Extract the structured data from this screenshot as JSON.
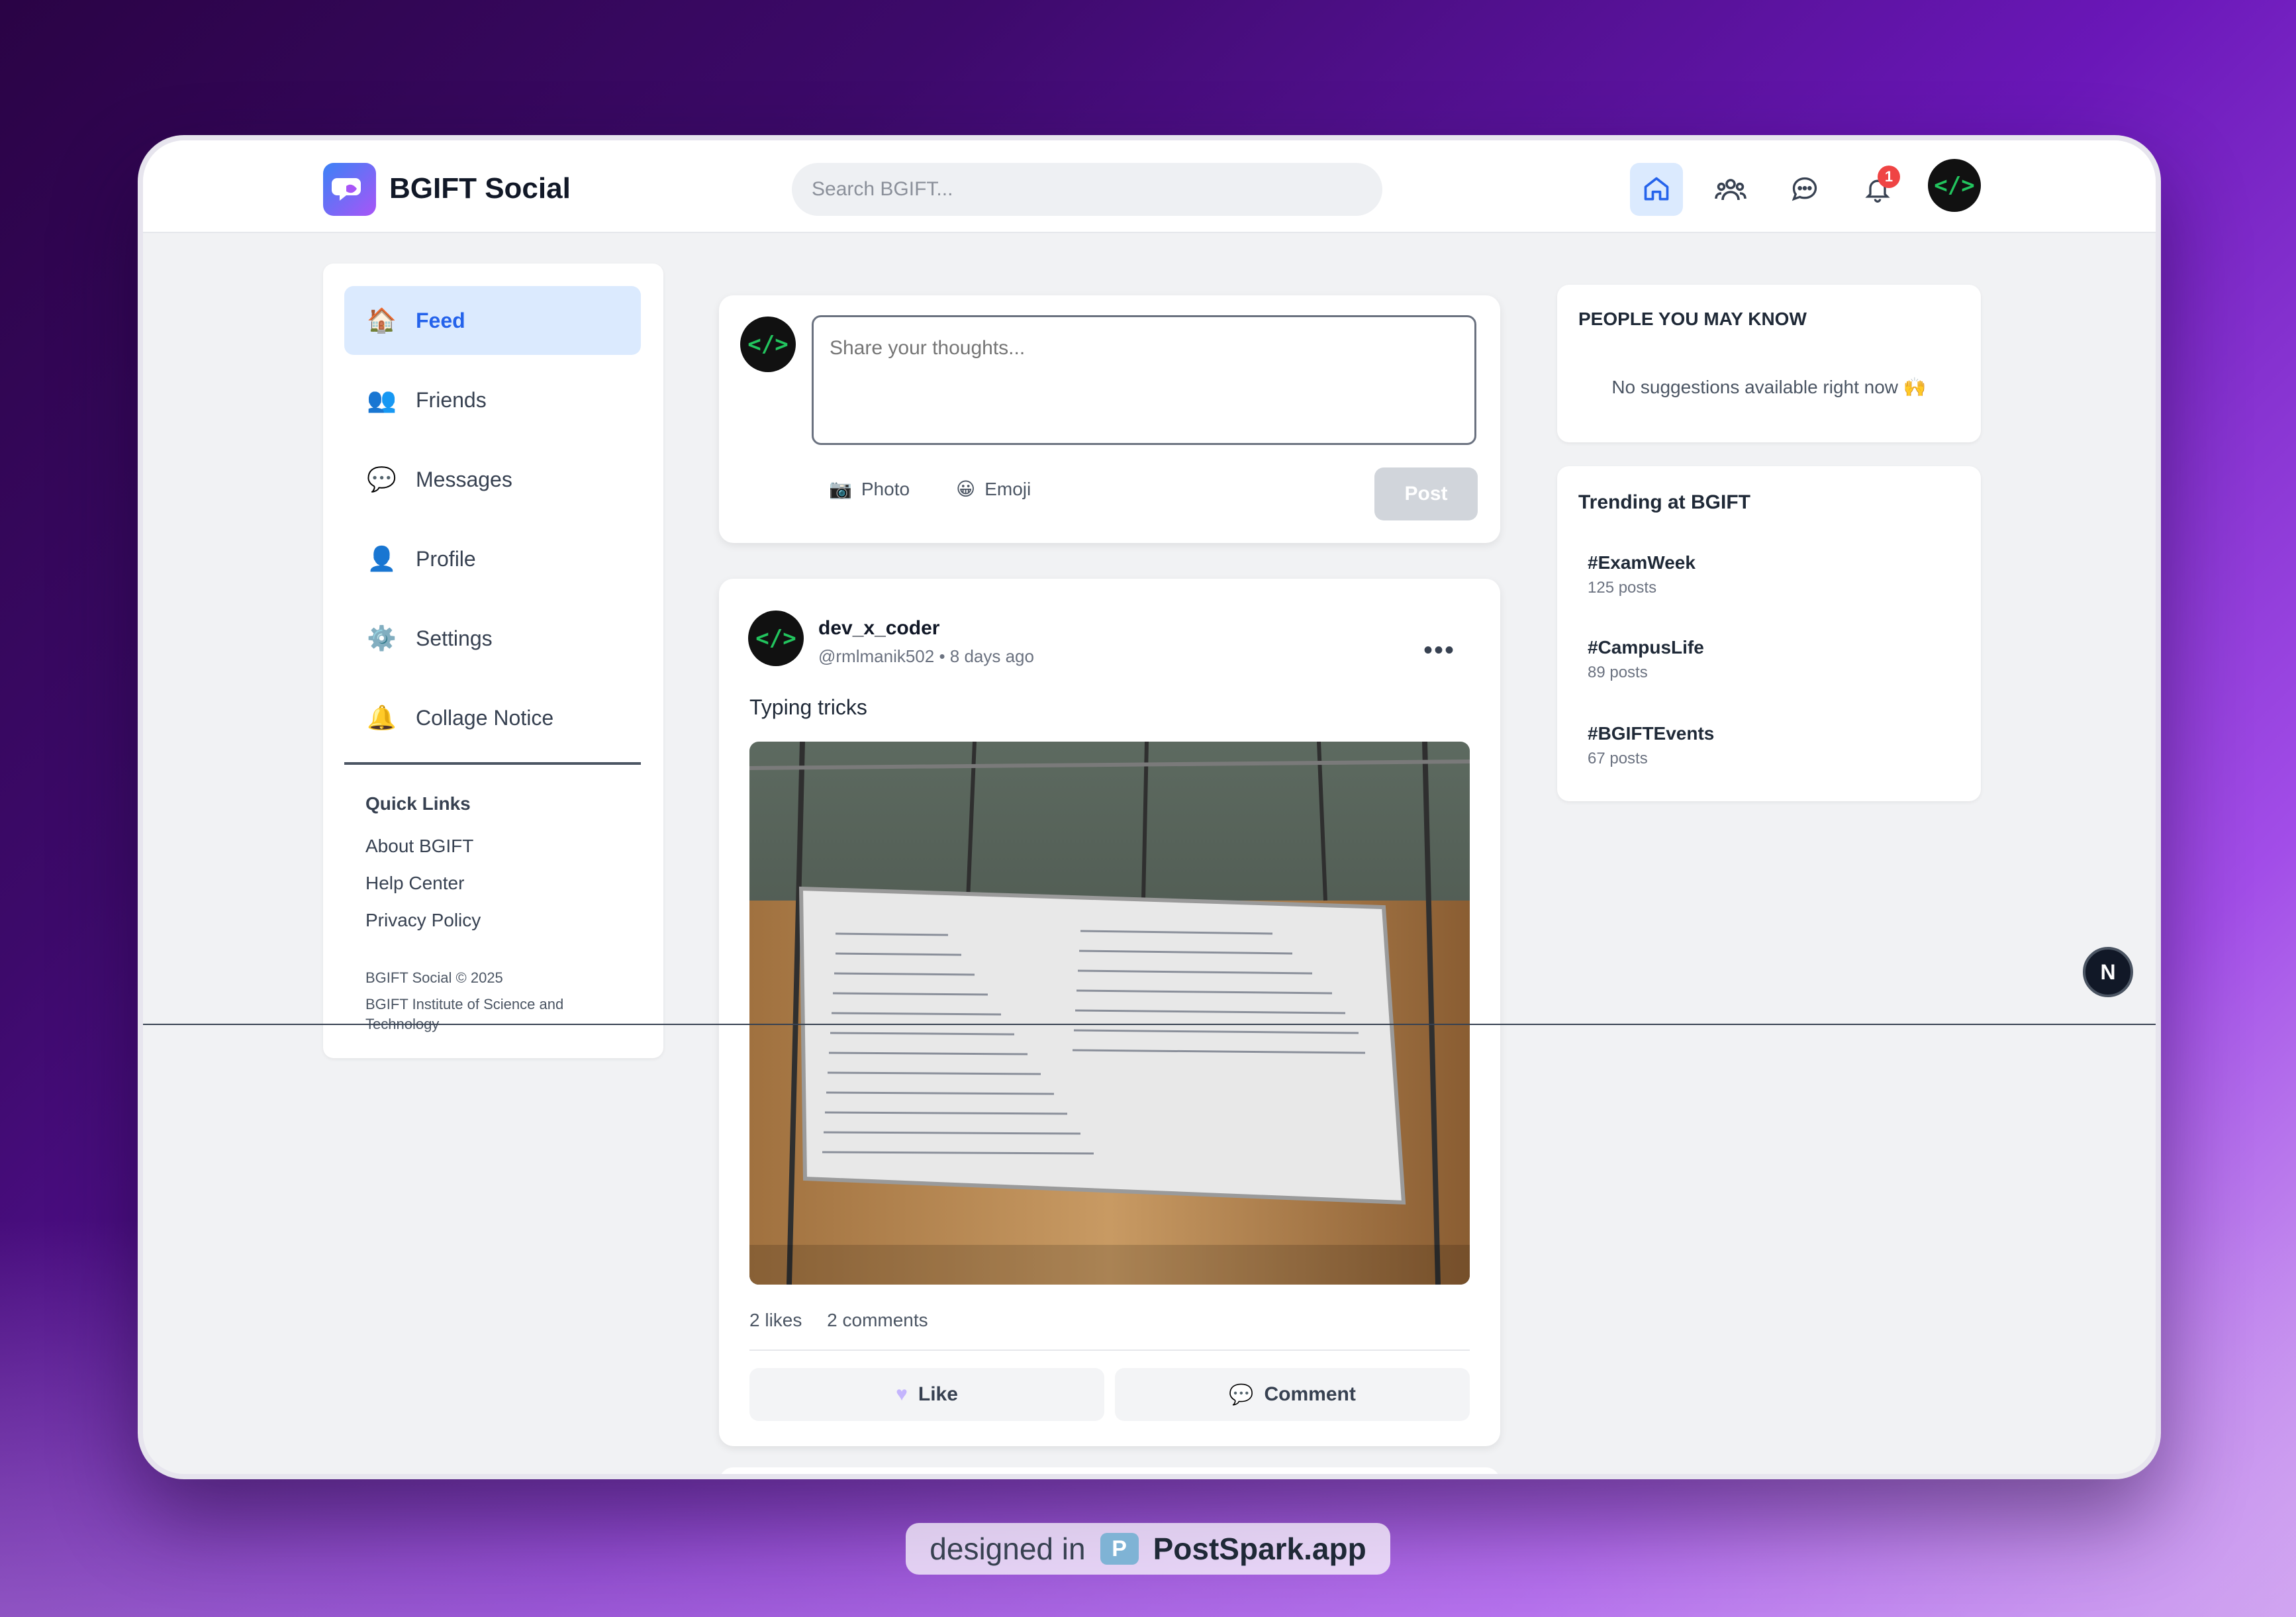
{
  "app": {
    "name": "BGIFT Social"
  },
  "search": {
    "placeholder": "Search BGIFT..."
  },
  "nav": {
    "notification_count": "1"
  },
  "avatar": {
    "glyph": "</>"
  },
  "sidebar": {
    "items": [
      {
        "label": "Feed",
        "icon": "house-icon",
        "emoji": "🏠"
      },
      {
        "label": "Friends",
        "icon": "people-icon",
        "emoji": "👥"
      },
      {
        "label": "Messages",
        "icon": "speech-bubble-icon",
        "emoji": "💬"
      },
      {
        "label": "Profile",
        "icon": "person-icon",
        "emoji": "👤"
      },
      {
        "label": "Settings",
        "icon": "gear-icon",
        "emoji": "⚙️"
      },
      {
        "label": "Collage Notice",
        "icon": "bell-icon",
        "emoji": "🔔"
      }
    ],
    "quick_links_title": "Quick Links",
    "quick_links": [
      "About BGIFT",
      "Help Center",
      "Privacy Policy"
    ],
    "footer_line1": "BGIFT Social © 2025",
    "footer_line2": "BGIFT Institute of Science and",
    "footer_line3": "Technology"
  },
  "composer": {
    "placeholder": "Share your thoughts...",
    "photo_label": "Photo",
    "emoji_label": "Emoji",
    "post_label": "Post"
  },
  "post": {
    "author": "dev_x_coder",
    "meta": "@rmlmanik502 • 8 days ago",
    "text": "Typing tricks",
    "likes": "2 likes",
    "comments": "2 comments",
    "like_label": "Like",
    "comment_label": "Comment"
  },
  "people": {
    "title": "PEOPLE YOU MAY KNOW",
    "empty": "No suggestions available right now 🙌"
  },
  "trending": {
    "title": "Trending at BGIFT",
    "items": [
      {
        "tag": "#ExamWeek",
        "count": "125 posts"
      },
      {
        "tag": "#CampusLife",
        "count": "89 posts"
      },
      {
        "tag": "#BGIFTEvents",
        "count": "67 posts"
      }
    ]
  },
  "floating": {
    "n_label": "N"
  },
  "brand": {
    "designed_in": "designed in",
    "name": "PostSpark.app"
  },
  "colors": {
    "accent": "#2563eb",
    "active_bg": "#dbeafe",
    "badge": "#ef4444",
    "code_green": "#22c55e"
  }
}
